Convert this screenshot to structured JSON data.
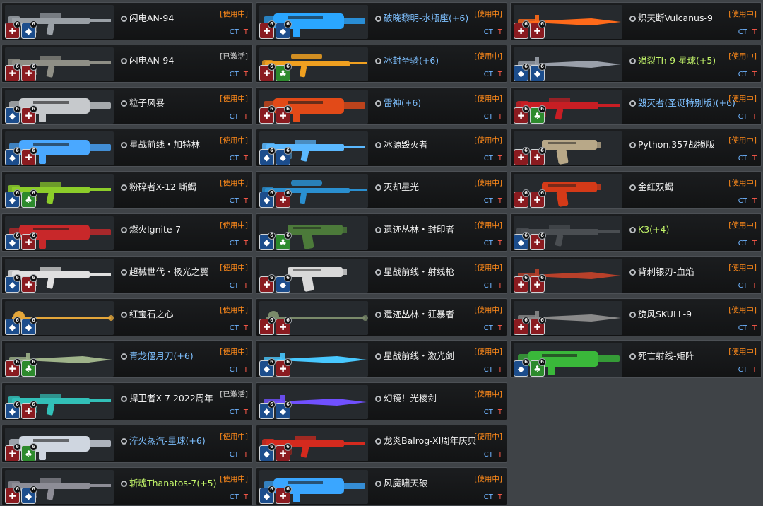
{
  "columns": [
    [
      {
        "name": "闪电AN-94",
        "status": "[使用中]",
        "color": "white",
        "badges": [
          "red",
          "blue"
        ],
        "gun": "rifle",
        "tint": "#9aa0a6"
      },
      {
        "name": "闪电AN-94",
        "status": "[已激活]",
        "color": "white",
        "badges": [
          "red",
          "red"
        ],
        "gun": "rifle",
        "tint": "#8f8f86"
      },
      {
        "name": "粒子风暴",
        "status": "[使用中]",
        "color": "white",
        "badges": [
          "blue",
          "red"
        ],
        "gun": "heavy",
        "tint": "#c6c9cc"
      },
      {
        "name": "星战前线・加特林",
        "status": "[使用中]",
        "color": "white",
        "badges": [
          "blue",
          "red"
        ],
        "gun": "heavy",
        "tint": "#4aa8ff"
      },
      {
        "name": "粉碎者X-12 嘶蝎",
        "status": "[使用中]",
        "color": "white",
        "badges": [
          "blue",
          "green"
        ],
        "gun": "rifle",
        "tint": "#8ccd2a"
      },
      {
        "name": "燃火Ignite-7",
        "status": "[使用中]",
        "color": "white",
        "badges": [
          "blue",
          "red"
        ],
        "gun": "heavy",
        "tint": "#c8282a"
      },
      {
        "name": "超械世代・极光之翼",
        "status": "[使用中]",
        "color": "white",
        "badges": [
          "blue",
          "red"
        ],
        "gun": "rifle",
        "tint": "#e0e0e0"
      },
      {
        "name": "红宝石之心",
        "status": "[使用中]",
        "color": "white",
        "badges": [
          "blue",
          "blue"
        ],
        "gun": "staff",
        "tint": "#e4a63a"
      },
      {
        "name": "青龙偃月刀(+6)",
        "status": "[使用中]",
        "color": "blue",
        "badges": [
          "red",
          "green"
        ],
        "gun": "blade",
        "tint": "#9fb38a"
      },
      {
        "name": "捍卫者X-7 2022周年",
        "status": "[已激活]",
        "color": "white",
        "badges": [
          "blue",
          "red"
        ],
        "gun": "rifle",
        "tint": "#32c0b8"
      },
      {
        "name": "淬火蒸汽-星球(+6)",
        "status": "[使用中]",
        "color": "blue",
        "badges": [
          "red",
          "green"
        ],
        "gun": "heavy",
        "tint": "#cfd6e0"
      },
      {
        "name": "斩魂Thanatos-7(+5)",
        "status": "[使用中]",
        "color": "green",
        "badges": [
          "red",
          "blue"
        ],
        "gun": "rifle",
        "tint": "#8d8d96"
      }
    ],
    [
      {
        "name": "破晓黎明-水瓶座(+6)",
        "status": "[使用中]",
        "color": "blue",
        "badges": [
          "red",
          "blue"
        ],
        "gun": "heavy",
        "tint": "#2aa6ff"
      },
      {
        "name": "冰封圣骑(+6)",
        "status": "[使用中]",
        "color": "blue",
        "badges": [
          "red",
          "green"
        ],
        "gun": "sniper",
        "tint": "#f0a020"
      },
      {
        "name": "雷神(+6)",
        "status": "[使用中]",
        "color": "blue",
        "badges": [
          "red",
          "red"
        ],
        "gun": "heavy",
        "tint": "#e24a18"
      },
      {
        "name": "冰源毁灭者",
        "status": "[使用中]",
        "color": "white",
        "badges": [
          "blue",
          "blue"
        ],
        "gun": "rifle",
        "tint": "#5ab8ff"
      },
      {
        "name": "灭却星光",
        "status": "[使用中]",
        "color": "white",
        "badges": [
          "blue",
          "red"
        ],
        "gun": "sniper",
        "tint": "#2a8fd0"
      },
      {
        "name": "遗迹丛林・封印者",
        "status": "[使用中]",
        "color": "white",
        "badges": [
          "blue",
          "green"
        ],
        "gun": "pistol",
        "tint": "#4c7a3a"
      },
      {
        "name": "星战前线・射线枪",
        "status": "[使用中]",
        "color": "white",
        "badges": [
          "red",
          "blue"
        ],
        "gun": "pistol",
        "tint": "#d8d8d8"
      },
      {
        "name": "遗迹丛林・狂暴者",
        "status": "[使用中]",
        "color": "white",
        "badges": [
          "red",
          "red"
        ],
        "gun": "staff",
        "tint": "#7a8a6a"
      },
      {
        "name": "星战前线・激光剑",
        "status": "[使用中]",
        "color": "white",
        "badges": [
          "blue",
          "red"
        ],
        "gun": "blade",
        "tint": "#48c8ff"
      },
      {
        "name": "幻镜！光棱剑",
        "status": "[使用中]",
        "color": "white",
        "badges": [
          "blue",
          "blue"
        ],
        "gun": "blade",
        "tint": "#7050ff"
      },
      {
        "name": "龙炎Balrog-XI周年庆典",
        "status": "[使用中]",
        "color": "white",
        "badges": [
          "blue",
          "red"
        ],
        "gun": "rifle",
        "tint": "#d42a1e"
      },
      {
        "name": "风魔啸天破",
        "status": "[使用中]",
        "color": "white",
        "badges": [
          "blue",
          "red"
        ],
        "gun": "heavy",
        "tint": "#3aa6ff"
      }
    ],
    [
      {
        "name": "炽天断Vulcanus-9",
        "status": "[使用中]",
        "color": "white",
        "badges": [
          "red",
          "red"
        ],
        "gun": "blade",
        "tint": "#ff6a1a"
      },
      {
        "name": "殒裂Th-9 星球(+5)",
        "status": "[使用中]",
        "color": "green",
        "badges": [
          "blue",
          "blue"
        ],
        "gun": "blade",
        "tint": "#9aa0aa"
      },
      {
        "name": "毁灭者(圣诞特别版)(+6)",
        "status": "[使用中]",
        "color": "blue",
        "badges": [
          "red",
          "green"
        ],
        "gun": "rifle",
        "tint": "#c81e24"
      },
      {
        "name": "Python.357战损版",
        "status": "[使用中]",
        "color": "white",
        "badges": [
          "red",
          "red"
        ],
        "gun": "pistol",
        "tint": "#b8a888"
      },
      {
        "name": "金红双蝎",
        "status": "[使用中]",
        "color": "white",
        "badges": [
          "red",
          "red"
        ],
        "gun": "pistol",
        "tint": "#d43a18"
      },
      {
        "name": "K3(+4)",
        "status": "[使用中]",
        "color": "green",
        "badges": [
          "blue",
          "red"
        ],
        "gun": "rifle",
        "tint": "#4a4e52"
      },
      {
        "name": "背刺银刃-血焰",
        "status": "[使用中]",
        "color": "white",
        "badges": [
          "red",
          "red"
        ],
        "gun": "blade",
        "tint": "#b8402a"
      },
      {
        "name": "旋风SKULL-9",
        "status": "[使用中]",
        "color": "white",
        "badges": [
          "red",
          "red"
        ],
        "gun": "blade",
        "tint": "#8a8a8a"
      },
      {
        "name": "死亡射线-矩阵",
        "status": "[使用中]",
        "color": "white",
        "badges": [
          "blue",
          "green"
        ],
        "gun": "heavy",
        "tint": "#3ab83a"
      }
    ]
  ],
  "team_labels": {
    "ct": "CT",
    "t": "T"
  },
  "badge_level": "6",
  "icon_names": {
    "gun": "weapon-image",
    "gear": "gear-icon",
    "badge": "effect-badge-icon"
  }
}
